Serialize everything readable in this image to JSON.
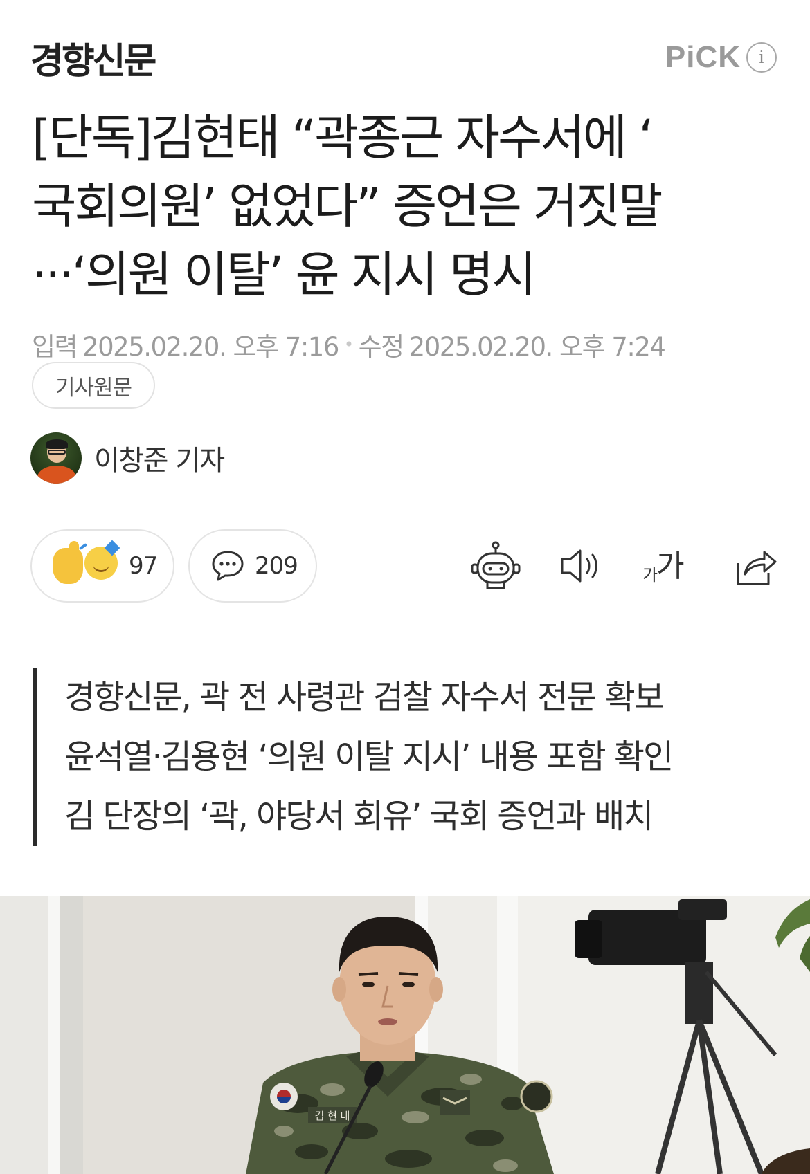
{
  "header": {
    "brand": "경향신문",
    "pick_label": "PiCK",
    "pick_info": "i"
  },
  "article": {
    "title": "[단독]김현태 “곽종근 자수서에 ‘\n국회의원’ 없었다” 증언은 거짓말\n···‘의원 이탈’ 윤 지시 명시",
    "input_label": "입력",
    "input_time": "2025.02.20. 오후 7:16",
    "edit_label": "수정",
    "edit_time": "2025.02.20. 오후 7:24",
    "original_button": "기사원문",
    "author": "이창준 기자"
  },
  "actions": {
    "reaction_count": "97",
    "comment_count": "209",
    "icons": [
      "robot-summary-icon",
      "speaker-icon",
      "font-size-icon",
      "share-icon"
    ],
    "font_size_small": "가",
    "font_size_large": "가"
  },
  "summary": {
    "lines": [
      "경향신문, 곽 전 사령관 검찰 자수서 전문 확보",
      "윤석열·김용현 ‘의원 이탈 지시’ 내용 포함 확인",
      "김 단장의 ‘곽, 야당서 회유’ 국회 증언과 배치"
    ]
  },
  "photo": {
    "nametag": "김 현 태"
  },
  "colors": {
    "text": "#1c1c1c",
    "meta": "#9b9b9b",
    "pick": "#9a9a9a",
    "border": "#e4e4e4",
    "summary_bar": "#2b2b2b"
  }
}
